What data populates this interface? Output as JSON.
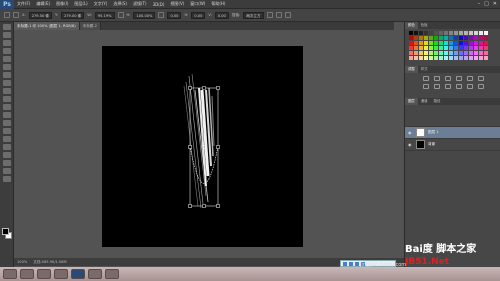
{
  "app": {
    "logo_text": "Ps"
  },
  "menu": [
    "文件(F)",
    "编辑(E)",
    "图像(I)",
    "图层(L)",
    "文字(Y)",
    "选择(S)",
    "滤镜(T)",
    "3D(D)",
    "视图(V)",
    "窗口(W)",
    "帮助(H)"
  ],
  "window_controls": {
    "minimize": "–",
    "maximize": "□",
    "close": "✕"
  },
  "options_bar": {
    "x_label": "X:",
    "x_value": "279.50 像",
    "y_label": "Y:",
    "y_value": "279.00 像",
    "w_label": "W:",
    "w_value": "95.19%",
    "h_label": "H:",
    "h_value": "100.00%",
    "angle_value": "0.00",
    "hskew_label": "H:",
    "hskew_value": "0.00",
    "vskew_label": "V:",
    "vskew_value": "0.00",
    "interp_label": "插值:",
    "interp_value": "两次立方"
  },
  "tabs": [
    {
      "label": "未标题-1 @ 100% (图层 1, RGB/8)",
      "active": true
    },
    {
      "label": "未标题-2",
      "active": false
    }
  ],
  "right_panel": {
    "color_tabs": [
      "颜色",
      "色板"
    ],
    "adjust_tabs": [
      "调整",
      "样式"
    ],
    "layers_tabs": [
      "图层",
      "通道",
      "路径"
    ],
    "layers": [
      {
        "name": "图层 1",
        "selected": true,
        "thumb_color": "#ffffff"
      },
      {
        "name": "背景",
        "selected": false,
        "thumb_color": "#000000"
      }
    ]
  },
  "status": {
    "zoom": "100%",
    "doc": "文档:585.9K/1.08M"
  },
  "watermark": {
    "line1": "Bai度 脚本之家",
    "line2": "JB51.Net",
    "line3": "jingyan.baidu.com"
  },
  "colors": {
    "accent": "#6b7e96",
    "canvas": "#000000",
    "workspace": "#535353"
  }
}
